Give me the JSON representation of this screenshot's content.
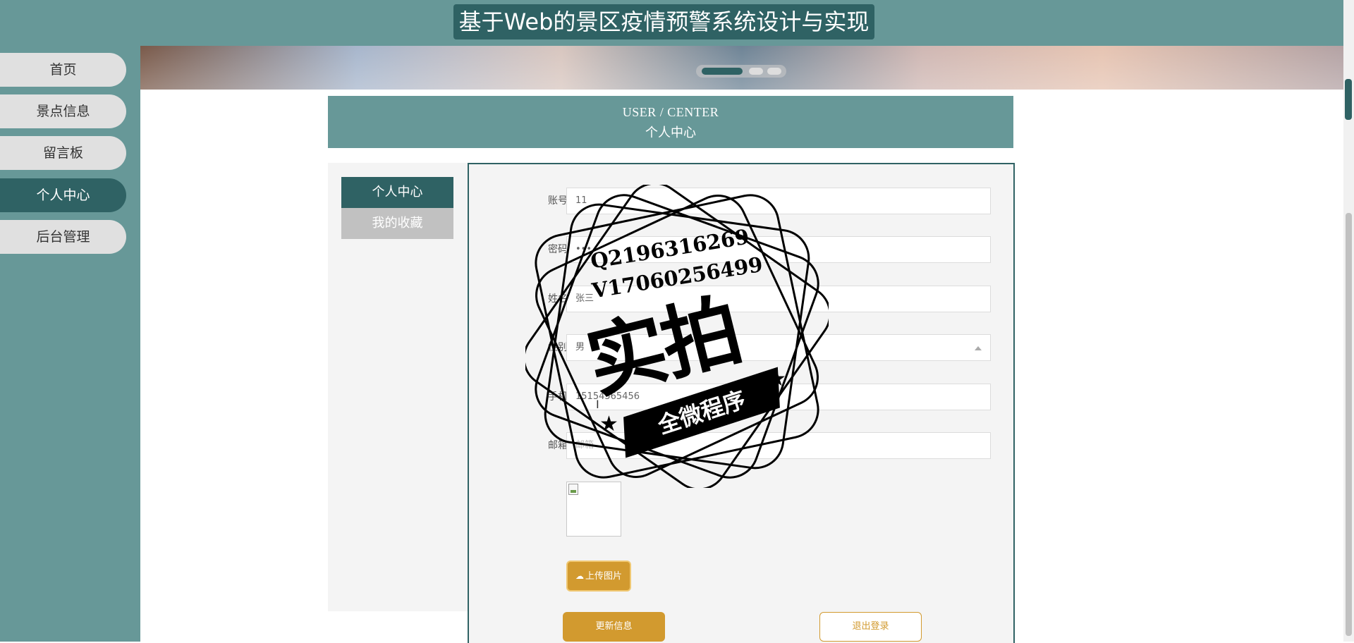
{
  "header": {
    "title": "基于Web的景区疫情预警系统设计与实现"
  },
  "sidebar": {
    "items": [
      {
        "label": "首页"
      },
      {
        "label": "景点信息"
      },
      {
        "label": "留言板"
      },
      {
        "label": "个人中心"
      },
      {
        "label": "后台管理"
      }
    ],
    "active_index": 3
  },
  "section": {
    "title_en": "USER / CENTER",
    "title_cn": "个人中心"
  },
  "left_menu": {
    "items": [
      {
        "label": "个人中心"
      },
      {
        "label": "我的收藏"
      }
    ]
  },
  "form": {
    "fields": [
      {
        "label": "账号",
        "value": "11"
      },
      {
        "label": "密码",
        "value": "•••"
      },
      {
        "label": "姓名",
        "value": "张三"
      },
      {
        "label": "性别",
        "value": "男"
      },
      {
        "label": "手机",
        "value": "15154565456"
      },
      {
        "label": "邮箱",
        "placeholder": "邮箱"
      }
    ],
    "upload_label": "上传图片",
    "update_label": "更新信息",
    "logout_label": "退出登录"
  },
  "watermark": {
    "line1": "Q2196316269",
    "line2": "V17060256499",
    "main": "实拍",
    "ribbon": "全微程序"
  },
  "colors": {
    "primary": "#679898",
    "dark": "#2f6264",
    "accent": "#d29a2f"
  }
}
